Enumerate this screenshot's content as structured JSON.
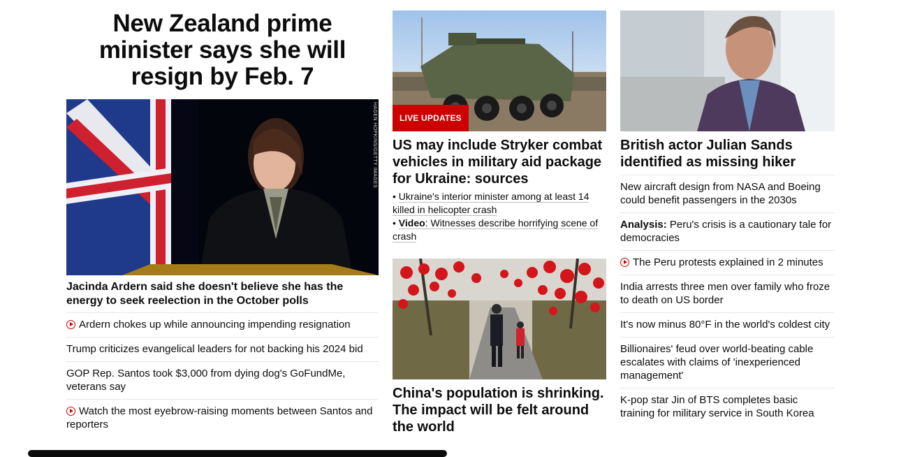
{
  "lead": {
    "headline": "New Zealand prime minister says she will resign by Feb. 7",
    "image_alt": "Jacinda Ardern at podium",
    "image_credit": "HAGEN HOPKINS/GETTY IMAGES",
    "caption": "Jacinda Ardern said she doesn't believe she has the energy to seek reelection in the October polls",
    "links": [
      {
        "text": "Ardern chokes up while announcing impending resignation",
        "video": true
      },
      {
        "text": "Trump criticizes evangelical leaders for not backing his 2024 bid",
        "video": false
      },
      {
        "text": "GOP Rep. Santos took $3,000 from dying dog's GoFundMe, veterans say",
        "video": false
      },
      {
        "text": "Watch the most eyebrow-raising moments between Santos and reporters",
        "video": true
      }
    ]
  },
  "middle": {
    "badge": "LIVE UPDATES",
    "headline": "US may include Stryker combat vehicles in military aid package for Ukraine: sources",
    "bullets": [
      {
        "prefix": "",
        "text": "Ukraine's interior minister among at least 14 killed in helicopter crash"
      },
      {
        "prefix": "Video",
        "text": ": Witnesses describe horrifying scene of crash"
      }
    ],
    "second_headline": "China's population is shrinking. The impact will be felt around the world"
  },
  "right": {
    "headline": "British actor Julian Sands identified as missing hiker",
    "links": [
      {
        "prefix": "",
        "text": "New aircraft design from NASA and Boeing could benefit passengers in the 2030s",
        "video": false
      },
      {
        "prefix": "Analysis:",
        "text": " Peru's crisis is a cautionary tale for democracies",
        "video": false
      },
      {
        "prefix": "",
        "text": "The Peru protests explained in 2 minutes",
        "video": true
      },
      {
        "prefix": "",
        "text": "India arrests three men over family who froze to death on US border",
        "video": false
      },
      {
        "prefix": "",
        "text": "It's now minus 80°F in the world's coldest city",
        "video": false
      },
      {
        "prefix": "",
        "text": "Billionaires' feud over world-beating cable escalates with claims of 'inexperienced management'",
        "video": false
      },
      {
        "prefix": "",
        "text": "K-pop star Jin of BTS completes basic training for military service in South Korea",
        "video": false
      }
    ]
  },
  "colors": {
    "accent": "#cc0000",
    "text": "#0c0c0c",
    "divider": "#e6e6e6"
  }
}
